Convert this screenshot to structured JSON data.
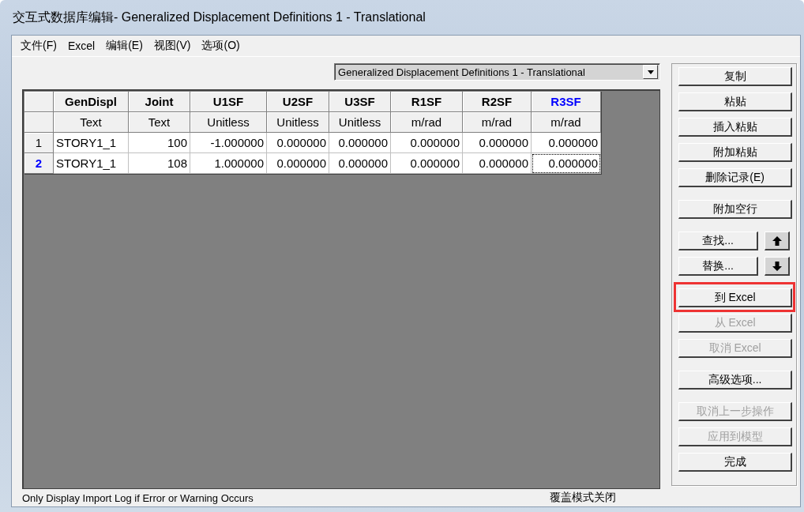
{
  "window": {
    "title": "交互式数据库编辑- Generalized Displacement Definitions 1 - Translational"
  },
  "menu": [
    "文件(F)",
    "Excel",
    "编辑(E)",
    "视图(V)",
    "选项(O)"
  ],
  "table_selector": {
    "value": "Generalized Displacement Definitions 1 - Translational"
  },
  "table": {
    "columns": [
      {
        "name": "GenDispl",
        "unit": "Text",
        "selected": false
      },
      {
        "name": "Joint",
        "unit": "Text",
        "selected": false
      },
      {
        "name": "U1SF",
        "unit": "Unitless",
        "selected": false
      },
      {
        "name": "U2SF",
        "unit": "Unitless",
        "selected": false
      },
      {
        "name": "U3SF",
        "unit": "Unitless",
        "selected": false
      },
      {
        "name": "R1SF",
        "unit": "m/rad",
        "selected": false
      },
      {
        "name": "R2SF",
        "unit": "m/rad",
        "selected": false
      },
      {
        "name": "R3SF",
        "unit": "m/rad",
        "selected": true
      }
    ],
    "rows": [
      {
        "number": "1",
        "selected": false,
        "cells": [
          "STORY1_1",
          "100",
          "-1.000000",
          "0.000000",
          "0.000000",
          "0.000000",
          "0.000000",
          "0.000000"
        ]
      },
      {
        "number": "2",
        "selected": true,
        "cells": [
          "STORY1_1",
          "108",
          "1.000000",
          "0.000000",
          "0.000000",
          "0.000000",
          "0.000000",
          "0.000000"
        ]
      }
    ]
  },
  "button_groups": [
    [
      {
        "kind": "button",
        "label": "复制",
        "disabled": false,
        "highlighted": false
      },
      {
        "kind": "button",
        "label": "粘贴",
        "disabled": false,
        "highlighted": false
      },
      {
        "kind": "button",
        "label": "插入粘贴",
        "disabled": false,
        "highlighted": false
      },
      {
        "kind": "button",
        "label": "附加粘贴",
        "disabled": false,
        "highlighted": false
      },
      {
        "kind": "button",
        "label": "删除记录(E)",
        "disabled": false,
        "highlighted": false
      }
    ],
    [
      {
        "kind": "button",
        "label": "附加空行",
        "disabled": false,
        "highlighted": false
      }
    ],
    [
      {
        "kind": "search_up",
        "label": "查找...",
        "disabled": false,
        "highlighted": false
      },
      {
        "kind": "search_down",
        "label": "替换...",
        "disabled": false,
        "highlighted": false
      }
    ],
    [
      {
        "kind": "button",
        "label": "到 Excel",
        "disabled": false,
        "highlighted": true
      },
      {
        "kind": "button",
        "label": "从 Excel",
        "disabled": true,
        "highlighted": false
      },
      {
        "kind": "button",
        "label": "取消 Excel",
        "disabled": true,
        "highlighted": false
      }
    ],
    [
      {
        "kind": "button",
        "label": "高级选项...",
        "disabled": false,
        "highlighted": false
      }
    ],
    [
      {
        "kind": "button",
        "label": "取消上一步操作",
        "disabled": true,
        "highlighted": false
      },
      {
        "kind": "button",
        "label": "应用到模型",
        "disabled": true,
        "highlighted": false
      },
      {
        "kind": "button",
        "label": "完成",
        "disabled": false,
        "highlighted": false
      }
    ]
  ],
  "status_bar": {
    "message": "Only Display Import Log if Error or Warning Occurs",
    "mode": "覆盖模式关闭"
  }
}
